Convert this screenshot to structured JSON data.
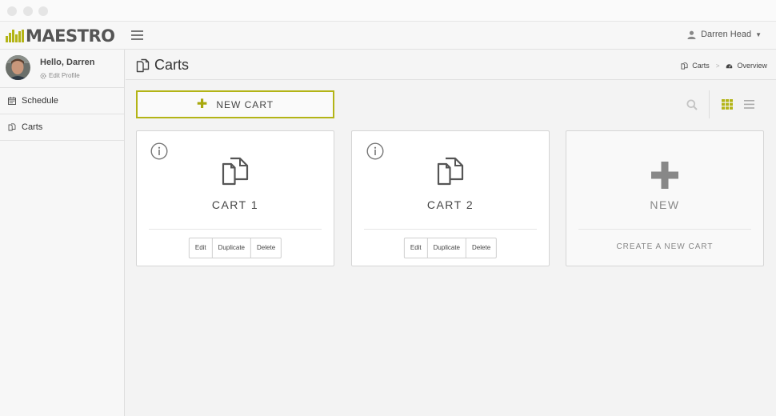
{
  "app": {
    "logo_text": "MAESTRO",
    "brand_color": "#b3b416"
  },
  "header": {
    "user_name": "Darren Head"
  },
  "sidebar": {
    "greeting": "Hello, Darren",
    "edit_profile": "Edit Profile",
    "items": [
      {
        "label": "Schedule",
        "icon": "calendar-icon"
      },
      {
        "label": "Carts",
        "icon": "copy-icon"
      }
    ]
  },
  "page": {
    "title": "Carts",
    "breadcrumb": [
      {
        "label": "Carts",
        "icon": "copy-icon"
      },
      {
        "label": "Overview",
        "icon": "dashboard-icon"
      }
    ],
    "new_cart_button": "NEW CART"
  },
  "cards": [
    {
      "title": "CART 1",
      "actions": [
        "Edit",
        "Duplicate",
        "Delete"
      ]
    },
    {
      "title": "CART 2",
      "actions": [
        "Edit",
        "Duplicate",
        "Delete"
      ]
    }
  ],
  "new_card": {
    "title": "NEW",
    "action": "CREATE A NEW CART"
  }
}
